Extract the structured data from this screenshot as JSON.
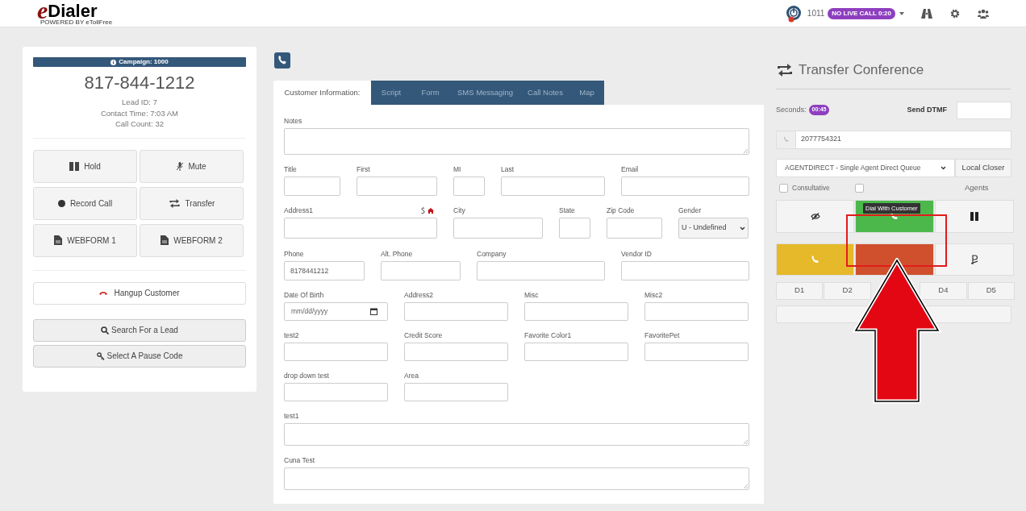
{
  "header": {
    "logo_letter": "e",
    "logo_word": "Dialer",
    "logo_tagline": "POWERED BY eTollFree",
    "agent_id": "1011",
    "call_status": "NO LIVE CALL 0:20"
  },
  "lead_card": {
    "campaign": "Campaign: 1000",
    "phone": "817-844-1212",
    "details": [
      "Lead ID: 7",
      "Contact Time: 7:03 AM",
      "Call Count: 32"
    ],
    "buttons": [
      {
        "label": "Hold",
        "kind": "pause"
      },
      {
        "label": "Mute",
        "kind": "mute"
      },
      {
        "label": "Record Call",
        "kind": "record"
      },
      {
        "label": "Transfer",
        "kind": "transfer"
      },
      {
        "label": "WEBFORM 1",
        "kind": "document"
      },
      {
        "label": "WEBFORM 2",
        "kind": "document"
      }
    ],
    "hangup": "Hangup Customer",
    "actions": [
      {
        "label": "Search For a Lead",
        "kind": "search"
      },
      {
        "label": "Select A Pause Code",
        "kind": "key"
      }
    ]
  },
  "tabs": [
    {
      "label": "Customer Information:",
      "selected": true
    },
    {
      "label": "Script",
      "selected": false
    },
    {
      "label": "Form",
      "selected": false
    },
    {
      "label": "SMS Messaging",
      "selected": false
    },
    {
      "label": "Call Notes",
      "selected": false
    },
    {
      "label": "Map",
      "selected": false
    }
  ],
  "form": {
    "rows": [
      [
        {
          "label": "Notes",
          "kind": "textarea"
        }
      ],
      [
        {
          "label": "Title",
          "kind": "input"
        },
        {
          "label": "First",
          "kind": "input"
        },
        {
          "label": "MI",
          "kind": "input"
        },
        {
          "label": "Last",
          "kind": "input"
        },
        {
          "label": "Email",
          "kind": "input"
        }
      ],
      [
        {
          "label": "Address1",
          "kind": "input",
          "lookup_icons": true
        },
        {
          "label": "City",
          "kind": "input"
        },
        {
          "label": "State",
          "kind": "input"
        },
        {
          "label": "Zip Code",
          "kind": "input"
        },
        {
          "label": "Gender",
          "kind": "select",
          "value": "U - Undefined"
        }
      ],
      [
        {
          "label": "Phone",
          "kind": "input",
          "value": "8178441212"
        },
        {
          "label": "Alt. Phone",
          "kind": "input"
        },
        {
          "label": "Company",
          "kind": "input"
        },
        {
          "label": "Vendor ID",
          "kind": "input"
        }
      ],
      [
        {
          "label": "Date Of Birth",
          "kind": "date",
          "placeholder": "mm/dd/yyyy"
        },
        {
          "label": "Address2",
          "kind": "input"
        },
        {
          "label": "Misc",
          "kind": "input"
        },
        {
          "label": "Misc2",
          "kind": "input"
        }
      ],
      [
        {
          "label": "test2",
          "kind": "input"
        },
        {
          "label": "Credit Score",
          "kind": "input"
        },
        {
          "label": "Favorite Color1",
          "kind": "input"
        },
        {
          "label": "FavoritePet",
          "kind": "input"
        }
      ],
      [
        {
          "label": "drop down test",
          "kind": "input"
        },
        {
          "label": "Area",
          "kind": "input"
        }
      ],
      [
        {
          "label": "test1",
          "kind": "textarea"
        }
      ],
      [
        {
          "label": "Cuna Test",
          "kind": "textarea"
        }
      ]
    ]
  },
  "transfer": {
    "title": "Transfer Conference",
    "seconds_label": "Seconds:",
    "seconds": "00:45",
    "dtmf_label": "Send DTMF",
    "number": "2077754321",
    "queue": "AGENTDIRECT - Single Agent Direct Queue",
    "closer_button": "Local Closer",
    "checkboxes": [
      {
        "label": "Consultative",
        "checked": false
      },
      {
        "checked": false
      }
    ],
    "agents_label": "Agents",
    "call_buttons": [
      {
        "kind": "hidden-eye",
        "color": "#f4f4f4"
      },
      {
        "kind": "phone",
        "color": "#4cb84c"
      },
      {
        "kind": "pause",
        "color": "#f4f4f4"
      },
      {
        "kind": "phone",
        "color": "#e6b92a"
      },
      {
        "kind": "blank",
        "color": "#d0502e"
      },
      {
        "kind": "p-symbol",
        "color": "#f4f4f4"
      }
    ],
    "dial_keys": [
      {
        "label": "D1"
      },
      {
        "label": "D2"
      },
      {
        "label": "D4"
      },
      {
        "label": "D5"
      }
    ],
    "tooltip": "Dial With Customer"
  }
}
